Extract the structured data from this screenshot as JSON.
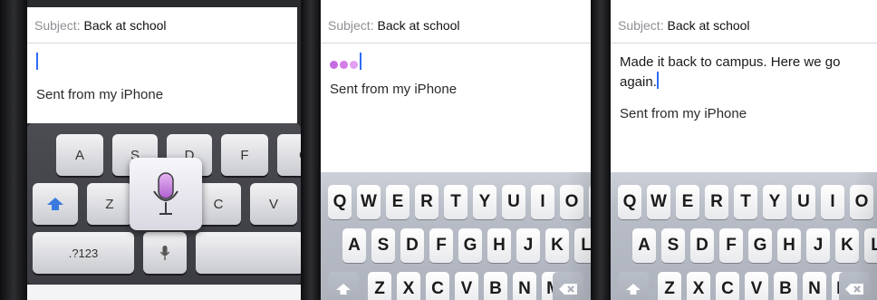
{
  "screens": [
    {
      "subject_label": "Subject:",
      "subject_value": "Back at school",
      "body_text": "",
      "signature": "Sent from my iPhone",
      "keyboard": {
        "row2": [
          "A",
          "S",
          "D",
          "F",
          "G"
        ],
        "row3": [
          "Z",
          "C",
          "V"
        ],
        "numbers_key": ".?123"
      }
    },
    {
      "subject_label": "Subject:",
      "subject_value": "Back at school",
      "body_text": "",
      "signature": "Sent from my iPhone"
    },
    {
      "subject_label": "Subject:",
      "subject_value": "Back at school",
      "body_text": "Made it back to campus. Here we go again.",
      "signature": "Sent from my iPhone"
    }
  ],
  "iphone_keyboard": {
    "row1": [
      "Q",
      "W",
      "E",
      "R",
      "T",
      "Y",
      "U",
      "I",
      "O",
      "P"
    ],
    "row2": [
      "A",
      "S",
      "D",
      "F",
      "G",
      "H",
      "J",
      "K",
      "L"
    ],
    "row3": [
      "Z",
      "X",
      "C",
      "V",
      "B",
      "N",
      "M"
    ]
  },
  "colors": {
    "cursor": "#2f6cf5",
    "dictation_dots": "#c56ce0",
    "siri_mic": "#c77ad8"
  },
  "icons": {
    "shift": "shift-arrow-icon",
    "microphone": "microphone-icon",
    "delete": "delete-backspace-icon"
  }
}
